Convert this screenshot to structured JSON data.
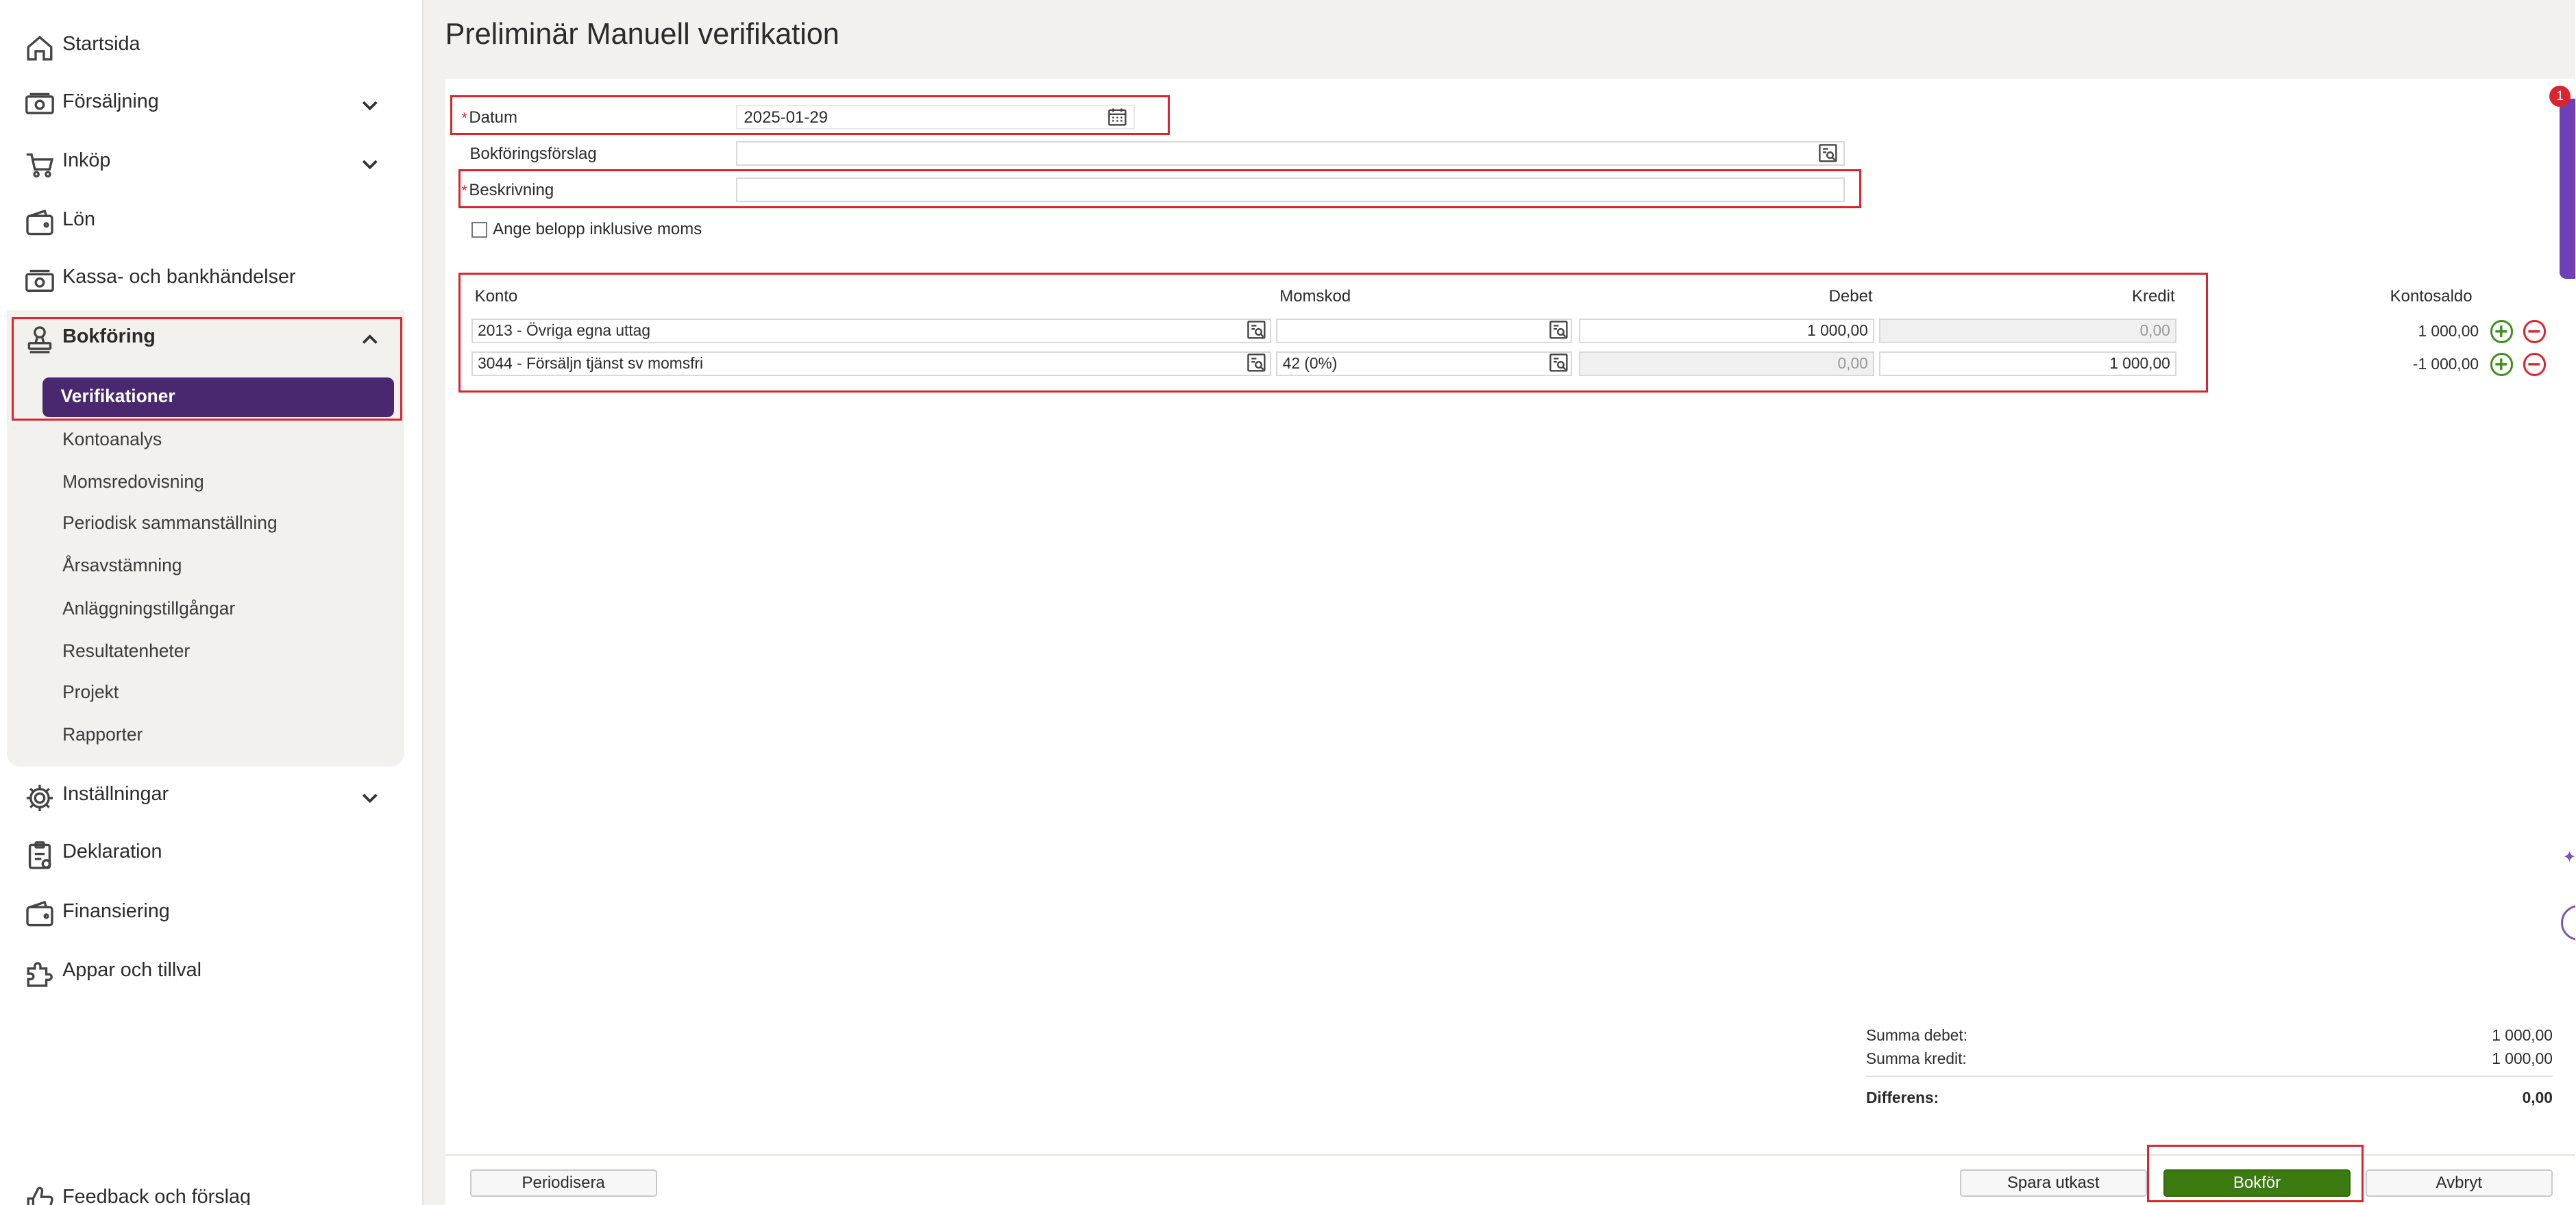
{
  "page": {
    "title": "Preliminär Manuell verifikation"
  },
  "sidebar": {
    "items": [
      {
        "label": "Startsida",
        "icon": "home-icon"
      },
      {
        "label": "Försäljning",
        "icon": "money-icon"
      },
      {
        "label": "Inköp",
        "icon": "cart-icon"
      },
      {
        "label": "Lön",
        "icon": "wallet-icon"
      },
      {
        "label": "Kassa- och bankhändelser",
        "icon": "bank-icon"
      },
      {
        "label": "Bokföring",
        "icon": "stamp-icon"
      },
      {
        "label": "Inställningar",
        "icon": "gear-icon"
      },
      {
        "label": "Deklaration",
        "icon": "clipboard-icon"
      },
      {
        "label": "Finansiering",
        "icon": "wallet-icon"
      },
      {
        "label": "Appar och tillval",
        "icon": "puzzle-icon"
      },
      {
        "label": "Feedback och förslag",
        "icon": "thumb-icon"
      }
    ],
    "bokforing_sub": [
      "Verifikationer",
      "Kontoanalys",
      "Momsredovisning",
      "Periodisk sammanställning",
      "Årsavstämning",
      "Anläggningstillgångar",
      "Resultatenheter",
      "Projekt",
      "Rapporter"
    ]
  },
  "form": {
    "datum_label": "Datum",
    "datum_value": "2025-01-29",
    "bokforingsforslag_label": "Bokföringsförslag",
    "bokforingsforslag_value": "",
    "beskrivning_label": "Beskrivning",
    "beskrivning_value": "",
    "inkl_moms_label": "Ange belopp inklusive moms",
    "required_mark": "*"
  },
  "table": {
    "headers": {
      "konto": "Konto",
      "momskod": "Momskod",
      "debet": "Debet",
      "kredit": "Kredit",
      "kontosaldo": "Kontosaldo"
    },
    "rows": [
      {
        "konto": "2013 - Övriga egna uttag",
        "momskod": "",
        "debet": "1 000,00",
        "kredit": "0,00",
        "kontosaldo": "1 000,00"
      },
      {
        "konto": "3044 - Försäljn tjänst sv momsfri",
        "momskod": "42 (0%)",
        "debet": "0,00",
        "kredit": "1 000,00",
        "kontosaldo": "-1 000,00"
      }
    ]
  },
  "summary": {
    "summa_debet_label": "Summa debet:",
    "summa_debet": "1 000,00",
    "summa_kredit_label": "Summa kredit:",
    "summa_kredit": "1 000,00",
    "differens_label": "Differens:",
    "differens": "0,00"
  },
  "buttons": {
    "periodisera": "Periodisera",
    "spara_utkast": "Spara utkast",
    "bokfor": "Bokför",
    "avbryt": "Avbryt"
  },
  "notification_count": "1",
  "colors": {
    "brand": "#4a2870",
    "accent_red": "#d9262e",
    "primary_green": "#3c7a12",
    "background": "#f3f1ee"
  }
}
